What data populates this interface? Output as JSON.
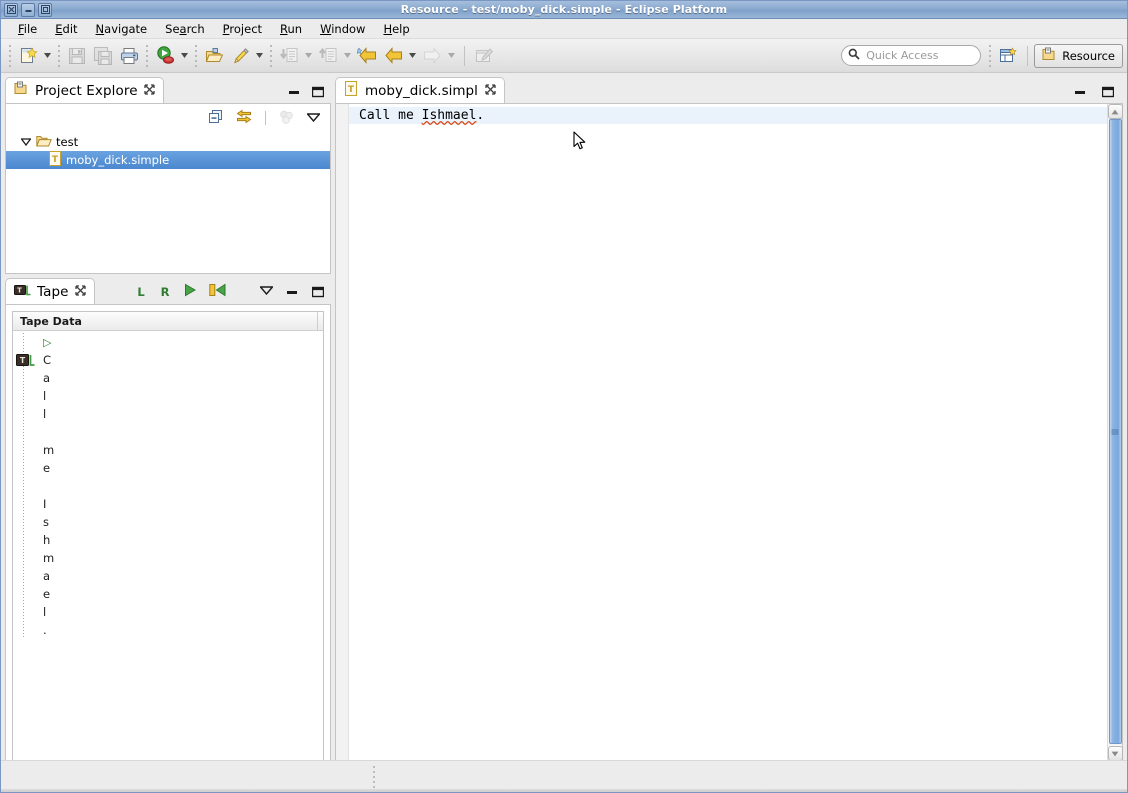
{
  "window": {
    "title": "Resource - test/moby_dick.simple - Eclipse Platform",
    "controls": {
      "close": "close-button",
      "minimize": "minimize-button",
      "maximize": "maximize-button"
    }
  },
  "menubar": {
    "items": [
      {
        "label": "File",
        "mnemonic": "F"
      },
      {
        "label": "Edit",
        "mnemonic": "E"
      },
      {
        "label": "Navigate",
        "mnemonic": "N"
      },
      {
        "label": "Search",
        "mnemonic": "a"
      },
      {
        "label": "Project",
        "mnemonic": "P"
      },
      {
        "label": "Run",
        "mnemonic": "R"
      },
      {
        "label": "Window",
        "mnemonic": "W"
      },
      {
        "label": "Help",
        "mnemonic": "H"
      }
    ]
  },
  "toolbar": {
    "items": [
      {
        "name": "new-wizard-icon",
        "enabled": true,
        "dropdown": true
      },
      {
        "name": "save-icon",
        "enabled": false,
        "dropdown": false
      },
      {
        "name": "save-all-icon",
        "enabled": false,
        "dropdown": false
      },
      {
        "name": "print-icon",
        "enabled": true,
        "dropdown": false
      },
      {
        "name": "run-icon",
        "enabled": true,
        "dropdown": true
      },
      {
        "name": "open-resource-icon",
        "enabled": true,
        "dropdown": false
      },
      {
        "name": "search-pen-icon",
        "enabled": true,
        "dropdown": true
      },
      {
        "name": "previous-annotation-icon",
        "enabled": false,
        "dropdown": true
      },
      {
        "name": "next-annotation-icon",
        "enabled": false,
        "dropdown": true
      },
      {
        "name": "back-history-icon",
        "enabled": true,
        "dropdown": false
      },
      {
        "name": "backward-icon",
        "enabled": true,
        "dropdown": true
      },
      {
        "name": "forward-icon",
        "enabled": false,
        "dropdown": true
      },
      {
        "name": "new-editor-icon",
        "enabled": false,
        "dropdown": false
      }
    ],
    "quick_access": {
      "placeholder": "Quick Access",
      "value": "",
      "icon": "search-icon"
    },
    "open_perspective": {
      "name": "open-perspective-icon"
    },
    "perspective": {
      "label": "Resource",
      "icon": "resource-perspective-icon"
    }
  },
  "project_explorer": {
    "tab_title": "Project Explore",
    "tab_icon": "project-explorer-icon",
    "close_icon": "close-tab-icon",
    "toolbar": [
      {
        "name": "collapse-all-icon",
        "enabled": true
      },
      {
        "name": "link-with-editor-icon",
        "enabled": true
      },
      {
        "name": "focus-on-active-task-icon",
        "enabled": false
      },
      {
        "name": "view-menu-icon",
        "enabled": true
      }
    ],
    "minimize_icon": "minimize-view-icon",
    "maximize_icon": "maximize-view-icon",
    "tree": [
      {
        "label": "test",
        "icon": "folder-icon",
        "expanded": true,
        "level": 0,
        "selected": false
      },
      {
        "label": "moby_dick.simple",
        "icon": "text-file-icon",
        "level": 1,
        "selected": true
      }
    ]
  },
  "tape_view": {
    "tab_title": "Tape",
    "tab_icon": "tape-icon",
    "close_icon": "close-tab-icon",
    "toolbar": [
      {
        "name": "move-left-button",
        "label": "L"
      },
      {
        "name": "move-right-button",
        "label": "R"
      },
      {
        "name": "run-tape-button",
        "label": ""
      },
      {
        "name": "rewind-tape-button",
        "label": ""
      },
      {
        "name": "view-menu-icon",
        "label": ""
      }
    ],
    "minimize_icon": "minimize-view-icon",
    "maximize_icon": "maximize-view-icon",
    "column_header": "Tape Data",
    "rows": [
      {
        "value": "▷",
        "head": false,
        "start_marker": true
      },
      {
        "value": "C",
        "head": true
      },
      {
        "value": "a",
        "head": false
      },
      {
        "value": "l",
        "head": false
      },
      {
        "value": "l",
        "head": false
      },
      {
        "value": "",
        "head": false
      },
      {
        "value": "m",
        "head": false
      },
      {
        "value": "e",
        "head": false
      },
      {
        "value": "",
        "head": false
      },
      {
        "value": "I",
        "head": false
      },
      {
        "value": "s",
        "head": false
      },
      {
        "value": "h",
        "head": false
      },
      {
        "value": "m",
        "head": false
      },
      {
        "value": "a",
        "head": false
      },
      {
        "value": "e",
        "head": false
      },
      {
        "value": "l",
        "head": false
      },
      {
        "value": ".",
        "head": false
      }
    ]
  },
  "editor": {
    "tab_title": "moby_dick.simpl",
    "tab_icon": "text-file-icon",
    "close_icon": "close-tab-icon",
    "minimize_icon": "minimize-view-icon",
    "maximize_icon": "maximize-view-icon",
    "lines": [
      {
        "prefix": "Call me ",
        "error_word": "Ishmael",
        "suffix": "."
      }
    ],
    "vertical_scrollbar": {
      "name": "editor-vertical-scrollbar"
    },
    "horizontal_scrollbar": {
      "name": "editor-horizontal-scrollbar"
    }
  },
  "status_bar": {
    "text": ""
  },
  "colors": {
    "title_bar": "#8cabd0",
    "selection": "#4a87cf",
    "line_highlight": "#eaf2fb",
    "error_squiggle": "#d84a1b",
    "tape_accent": "#2f7d32",
    "scrollbar_thumb": "#8cb3e2"
  }
}
